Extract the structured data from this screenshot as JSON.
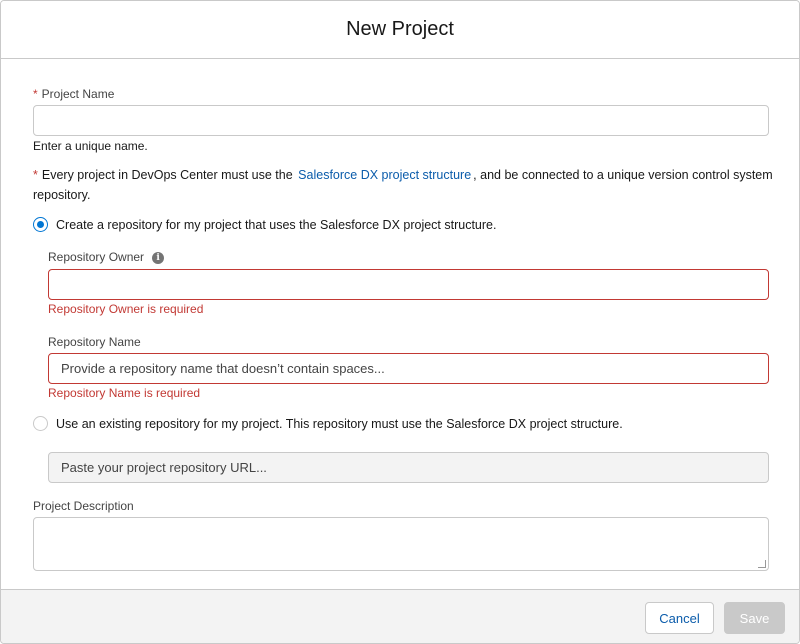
{
  "modal": {
    "title": "New Project"
  },
  "project_name": {
    "required_mark": "*",
    "label": "Project Name",
    "value": "",
    "help": "Enter a unique name."
  },
  "structure_note": {
    "required_mark": "*",
    "text_before": "Every project in DevOps Center must use the",
    "link": "Salesforce DX project structure",
    "text_after": ", and be connected to a unique version control system repository."
  },
  "option_create": {
    "label": "Create a repository for my project that uses the Salesforce DX project structure.",
    "checked": true
  },
  "repository_owner": {
    "label": "Repository Owner",
    "info_glyph": "i",
    "value": "",
    "error": "Repository Owner is required"
  },
  "repository_name": {
    "label": "Repository Name",
    "placeholder": "Provide a repository name that doesn’t contain spaces...",
    "error": "Repository Name is required"
  },
  "option_existing": {
    "label": "Use an existing repository for my project. This repository must use the Salesforce DX project structure.",
    "checked": false
  },
  "repository_url": {
    "placeholder": "Paste your project repository URL..."
  },
  "project_description": {
    "label": "Project Description",
    "value": ""
  },
  "footer": {
    "cancel_label": "Cancel",
    "save_label": "Save"
  },
  "colors": {
    "brand_blue": "#0176d3",
    "link_blue": "#0b5cab",
    "error_red": "#c23934",
    "border_gray": "#c9c9c9"
  }
}
